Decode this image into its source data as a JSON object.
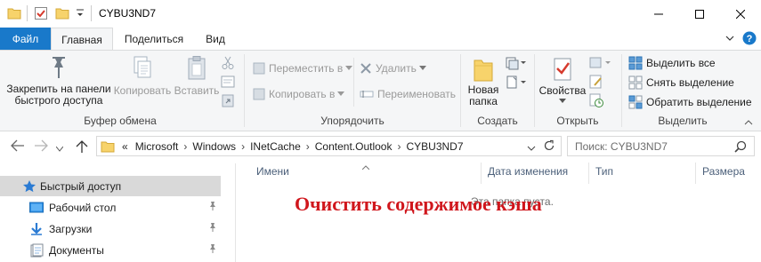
{
  "window": {
    "title": "CYBU3ND7"
  },
  "ribbon_tabs": {
    "file": "Файл",
    "home": "Главная",
    "share": "Поделиться",
    "view": "Вид"
  },
  "clipboard": {
    "pin_label": "Закрепить на панели быстрого доступа",
    "pin_line1": "Закрепить на панели",
    "pin_line2": "быстрого доступа",
    "copy": "Копировать",
    "paste": "Вставить",
    "group": "Буфер обмена"
  },
  "organize": {
    "move": "Переместить в",
    "copy_to": "Копировать в",
    "delete": "Удалить",
    "rename": "Переименовать",
    "group": "Упорядочить"
  },
  "create": {
    "new_folder_line1": "Новая",
    "new_folder_line2": "папка",
    "group": "Создать"
  },
  "open": {
    "properties": "Свойства",
    "group": "Открыть"
  },
  "select": {
    "select_all": "Выделить все",
    "select_none": "Снять выделение",
    "invert": "Обратить выделение",
    "group": "Выделить"
  },
  "address": {
    "overflow": "«",
    "crumbs": [
      "Microsoft",
      "Windows",
      "INetCache",
      "Content.Outlook",
      "CYBU3ND7"
    ],
    "search_placeholder": "Поиск: CYBU3ND7"
  },
  "navpane": {
    "items": [
      {
        "label": "Быстрый доступ",
        "icon": "star-icon"
      },
      {
        "label": "Рабочий стол",
        "icon": "desktop-icon"
      },
      {
        "label": "Загрузки",
        "icon": "download-icon"
      },
      {
        "label": "Документы",
        "icon": "documents-icon"
      }
    ]
  },
  "columns": {
    "name": "Имени",
    "date": "Дата изменения",
    "type": "Тип",
    "size": "Размера"
  },
  "list": {
    "empty_message": "Эта папка пуста."
  },
  "overlay_text": "Очистить содержимое кэша",
  "colors": {
    "file_tab": "#1979ca",
    "overlay": "#d0161c",
    "selected_nav": "#d9d9d9"
  }
}
